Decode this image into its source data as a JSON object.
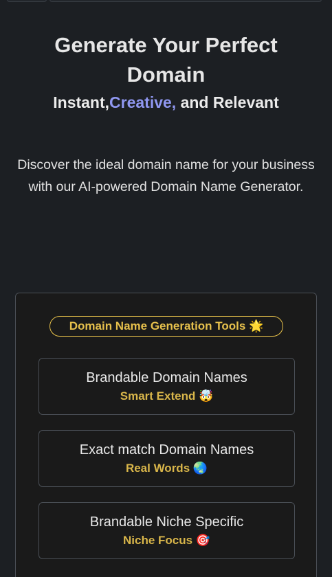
{
  "hero": {
    "title_line1": "Generate Your Perfect",
    "title_line2": "Domain",
    "subtitle_prefix": "Instant,",
    "subtitle_accent": "Creative,",
    "subtitle_suffix": " and Relevant",
    "description": "Discover the ideal domain name for your business with our AI-powered Domain Name Generator."
  },
  "tools": {
    "badge_label": "Domain Name Generation Tools",
    "badge_emoji": "🌟",
    "items": [
      {
        "title": "Brandable Domain Names",
        "tag": "Smart Extend",
        "emoji": "🤯"
      },
      {
        "title": "Exact match Domain Names",
        "tag": "Real Words",
        "emoji": "🌏"
      },
      {
        "title": "Brandable Niche Specific",
        "tag": "Niche Focus",
        "emoji": "🎯"
      }
    ]
  },
  "colors": {
    "background": "#1c1f23",
    "accent": "#8f97f0",
    "gold": "#e6c04c",
    "border": "#4a4f56"
  }
}
